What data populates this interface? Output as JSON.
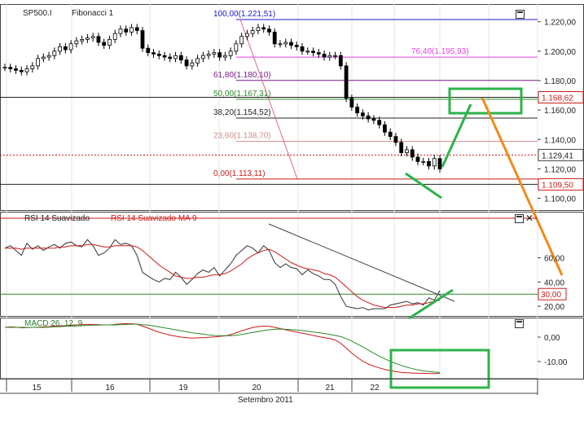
{
  "header": {
    "symbol": "SP500.I",
    "study": "Fibonacci 1",
    "rsi_label": "RSI 14 Suavizado",
    "rsi_ma_label": "RSI 14 Suavizado MA 9",
    "macd_label": "MACD 26, 12, 9",
    "month_label": "Setembro 2011"
  },
  "colors": {
    "up": "#000000",
    "down": "#000000",
    "fib100": "#1a1acc",
    "fib764": "#e040e0",
    "fib618": "#7a1a8a",
    "fib50": "#2a8a2a",
    "fib382": "#222222",
    "fib236": "#d48a8a",
    "fib0": "#cc1a1a",
    "annotation_green": "#2db34a",
    "annotation_orange": "#f08a1a",
    "price_marker": "#cc1a1a"
  },
  "chart_data": [
    {
      "type": "candlestick",
      "panel": "price",
      "ylim": [
        1.092,
        1.232
      ],
      "yticks": [
        "1.220,00",
        "1.200,00",
        "1.180,00",
        "1.160,00",
        "1.140,00",
        "1.120,00",
        "1.100,00"
      ],
      "ytick_values": [
        1.22,
        1.2,
        1.18,
        1.16,
        1.14,
        1.12,
        1.1
      ],
      "xlabels": [
        "15",
        "16",
        "19",
        "20",
        "21",
        "22"
      ],
      "fib_levels": [
        {
          "label": "100,00(1.221,51)",
          "value": 1.22151,
          "key": "fib100"
        },
        {
          "label": "76,40(1.195,93)",
          "value": 1.19593,
          "key": "fib764"
        },
        {
          "label": "61,80(1.180,10)",
          "value": 1.1801,
          "key": "fib618"
        },
        {
          "label": "50,00(1.167,31)",
          "value": 1.16731,
          "key": "fib50"
        },
        {
          "label": "38,20(1.154,52)",
          "value": 1.15452,
          "key": "fib382"
        },
        {
          "label": "23,60(1.138,70)",
          "value": 1.1387,
          "key": "fib236"
        },
        {
          "label": "0,00(1.113,11)",
          "value": 1.11311,
          "key": "fib0"
        }
      ],
      "price_tags": [
        {
          "label": "1.168,62",
          "value": 1.16862
        },
        {
          "label": "1.129,41",
          "value": 1.12941
        },
        {
          "label": "1.109,50",
          "value": 1.1095
        }
      ],
      "series": [
        {
          "values": [
            1.189,
            1.188,
            1.187,
            1.186,
            1.188,
            1.19,
            1.195,
            1.196,
            1.197,
            1.2,
            1.203,
            1.201,
            1.205,
            1.207,
            1.208,
            1.209,
            1.21,
            1.206,
            1.204,
            1.208,
            1.212,
            1.215,
            1.213,
            1.216,
            1.214,
            1.202,
            1.199,
            1.198,
            1.197,
            1.196,
            1.195,
            1.197,
            1.194,
            1.19,
            1.192,
            1.195,
            1.197,
            1.198,
            1.199,
            1.196,
            1.197,
            1.2,
            1.205,
            1.21,
            1.212,
            1.214,
            1.216,
            1.215,
            1.213,
            1.205,
            1.205,
            1.206,
            1.204,
            1.203,
            1.2,
            1.2,
            1.199,
            1.198,
            1.196,
            1.197,
            1.197,
            1.19,
            1.168,
            1.162,
            1.158,
            1.156,
            1.154,
            1.153,
            1.15,
            1.145,
            1.142,
            1.138,
            1.131,
            1.133,
            1.128,
            1.125,
            1.125,
            1.122,
            1.127,
            1.12
          ]
        }
      ]
    },
    {
      "type": "line",
      "panel": "rsi",
      "ylim": [
        12,
        98
      ],
      "yticks": [
        "60,00",
        "40,00",
        "20,00"
      ],
      "ytick_values": [
        60,
        40,
        20
      ],
      "hline_tag": "30,00",
      "hline_value": 30,
      "series": [
        {
          "name": "RSI 14 Suavizado",
          "values": [
            68,
            70,
            66,
            62,
            72,
            67,
            70,
            66,
            69,
            71,
            68,
            72,
            73,
            70,
            69,
            75,
            70,
            62,
            64,
            68,
            75,
            71,
            72,
            70,
            62,
            48,
            45,
            42,
            40,
            43,
            42,
            48,
            44,
            38,
            42,
            47,
            50,
            48,
            52,
            45,
            50,
            55,
            62,
            66,
            70,
            68,
            64,
            70,
            66,
            56,
            52,
            55,
            52,
            51,
            46,
            50,
            47,
            45,
            42,
            42,
            38,
            28,
            20,
            19,
            18,
            19,
            17,
            18,
            18,
            18,
            21,
            22,
            23,
            24,
            22,
            23,
            21,
            27,
            25,
            33
          ]
        },
        {
          "name": "RSI 14 Suavizado MA 9",
          "values": [
            68,
            68,
            68,
            67,
            68,
            68,
            68,
            68,
            68,
            68,
            69,
            69,
            70,
            70,
            70,
            71,
            71,
            70,
            69,
            69,
            70,
            70,
            70,
            70,
            69,
            66,
            62,
            58,
            54,
            51,
            48,
            45,
            44,
            43,
            43,
            44,
            44,
            45,
            46,
            46,
            47,
            49,
            52,
            55,
            59,
            62,
            64,
            66,
            67,
            65,
            62,
            59,
            56,
            54,
            52,
            51,
            50,
            49,
            47,
            46,
            44,
            40,
            36,
            32,
            28,
            25,
            23,
            21,
            20,
            19,
            19,
            19,
            20,
            21,
            21,
            22,
            22,
            23,
            24,
            25
          ]
        }
      ]
    },
    {
      "type": "line",
      "panel": "macd",
      "ylim": [
        -17,
        8
      ],
      "yticks": [
        "0,00",
        "-10,00"
      ],
      "ytick_values": [
        0,
        -10
      ],
      "series": [
        {
          "name": "MACD",
          "values": [
            4,
            4.2,
            4.1,
            3.8,
            3.9,
            4,
            4.1,
            4.2,
            4.3,
            4.5,
            4.6,
            4.7,
            4.9,
            5,
            5.1,
            5.2,
            5.2,
            5.1,
            5,
            5,
            5.2,
            5.4,
            5.5,
            5.5,
            5.3,
            4.5,
            3.7,
            2.8,
            2,
            1.4,
            0.8,
            0.4,
            0,
            -0.2,
            -0.4,
            -0.3,
            -0.2,
            -0.1,
            0.1,
            0.3,
            0.5,
            1,
            1.8,
            2.6,
            3.3,
            3.9,
            4.3,
            4.5,
            4.4,
            4,
            3.5,
            3,
            2.5,
            2.1,
            1.6,
            1.2,
            0.7,
            0.2,
            -0.2,
            -0.6,
            -1.2,
            -2.5,
            -4.5,
            -6.5,
            -8.3,
            -9.8,
            -11,
            -11.9,
            -12.6,
            -13.2,
            -13.7,
            -14.1,
            -14.4,
            -14.6,
            -14.7,
            -14.8,
            -14.8,
            -14.9,
            -14.9,
            -14.8
          ]
        },
        {
          "name": "Signal",
          "values": [
            4,
            4,
            4,
            4,
            4,
            4,
            4,
            4,
            4.1,
            4.2,
            4.3,
            4.4,
            4.5,
            4.6,
            4.7,
            4.8,
            4.9,
            4.9,
            5,
            5,
            5,
            5.1,
            5.2,
            5.3,
            5.3,
            5.1,
            4.9,
            4.6,
            4.2,
            3.8,
            3.4,
            3,
            2.6,
            2.2,
            1.8,
            1.5,
            1.2,
            0.9,
            0.7,
            0.6,
            0.6,
            0.6,
            0.8,
            1.1,
            1.5,
            1.9,
            2.3,
            2.7,
            3,
            3.2,
            3.3,
            3.2,
            3.1,
            2.9,
            2.7,
            2.4,
            2.1,
            1.8,
            1.5,
            1.1,
            0.7,
            0.2,
            -0.6,
            -1.6,
            -2.8,
            -4,
            -5.3,
            -6.6,
            -7.8,
            -8.9,
            -9.9,
            -10.8,
            -11.6,
            -12.3,
            -12.9,
            -13.4,
            -13.8,
            -14.1,
            -14.3,
            -14.4
          ]
        }
      ]
    }
  ]
}
